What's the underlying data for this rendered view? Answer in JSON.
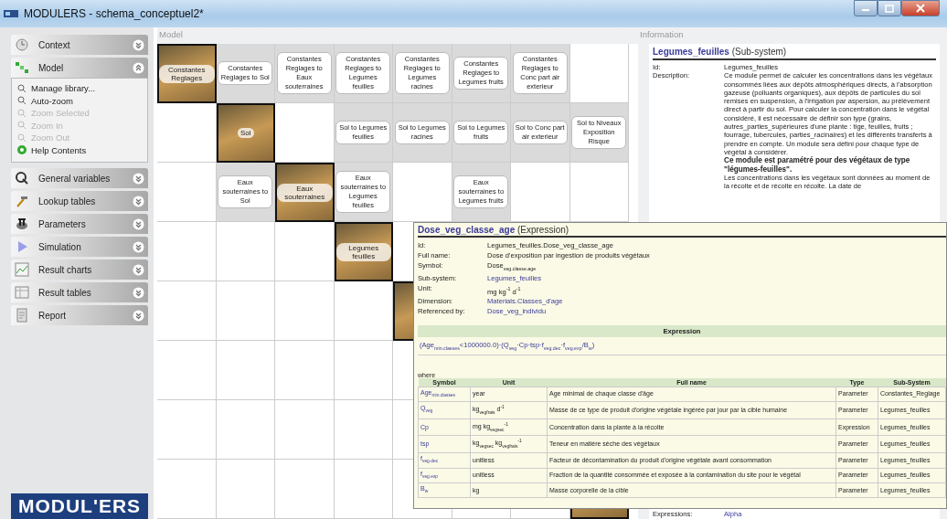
{
  "window": {
    "title": "MODULERS - schema_conceptuel2*"
  },
  "sidebar": {
    "sections": [
      {
        "label": "Context",
        "expanded": false
      },
      {
        "label": "Model",
        "expanded": true,
        "items": [
          {
            "label": "Manage library...",
            "disabled": false
          },
          {
            "label": "Auto-zoom",
            "disabled": false
          },
          {
            "label": "Zoom Selected",
            "disabled": true
          },
          {
            "label": "Zoom In",
            "disabled": true
          },
          {
            "label": "Zoom Out",
            "disabled": true
          },
          {
            "label": "Help Contents",
            "disabled": false
          }
        ]
      },
      {
        "label": "General variables",
        "expanded": false
      },
      {
        "label": "Lookup tables",
        "expanded": false
      },
      {
        "label": "Parameters",
        "expanded": false
      },
      {
        "label": "Simulation",
        "expanded": false
      },
      {
        "label": "Result charts",
        "expanded": false
      },
      {
        "label": "Result tables",
        "expanded": false
      },
      {
        "label": "Report",
        "expanded": false
      }
    ],
    "logo": "MODUL'ERS"
  },
  "model": {
    "legend": "Model",
    "rows": [
      [
        {
          "kind": "node",
          "label": "Constantes Reglages"
        },
        {
          "kind": "link",
          "label": "Constantes Reglages to Sol"
        },
        {
          "kind": "link",
          "label": "Constantes Reglages to Eaux souterraines"
        },
        {
          "kind": "link",
          "label": "Constantes Reglages to Legumes feuilles"
        },
        {
          "kind": "link",
          "label": "Constantes Reglages to Legumes racines"
        },
        {
          "kind": "link",
          "label": "Constantes Reglages to Legumes fruits"
        },
        {
          "kind": "link",
          "label": "Constantes Reglages to Conc part air exterieur"
        },
        {
          "kind": "empty"
        }
      ],
      [
        {
          "kind": "empty"
        },
        {
          "kind": "node",
          "label": "Sol"
        },
        {
          "kind": "empty"
        },
        {
          "kind": "link",
          "label": "Sol to Legumes feuilles"
        },
        {
          "kind": "link",
          "label": "Sol to Legumes racines"
        },
        {
          "kind": "link",
          "label": "Sol to Legumes fruits"
        },
        {
          "kind": "link",
          "label": "Sol to Conc part air exterieur"
        },
        {
          "kind": "link",
          "label": "Sol to Niveaux Exposition Risque"
        }
      ],
      [
        {
          "kind": "empty"
        },
        {
          "kind": "link",
          "label": "Eaux souterraines to Sol"
        },
        {
          "kind": "node",
          "label": "Eaux souterraines"
        },
        {
          "kind": "link",
          "label": "Eaux souterraines to Legumes feuilles"
        },
        {
          "kind": "empty"
        },
        {
          "kind": "link",
          "label": "Eaux souterraines to Legumes fruits"
        },
        {
          "kind": "empty"
        },
        {
          "kind": "empty"
        }
      ],
      [
        {
          "kind": "empty"
        },
        {
          "kind": "empty"
        },
        {
          "kind": "empty"
        },
        {
          "kind": "node",
          "label": "Legumes feuilles"
        },
        {
          "kind": "empty"
        },
        {
          "kind": "empty"
        },
        {
          "kind": "empty"
        },
        {
          "kind": "empty"
        }
      ],
      [
        {
          "kind": "empty"
        },
        {
          "kind": "empty"
        },
        {
          "kind": "empty"
        },
        {
          "kind": "empty"
        },
        {
          "kind": "node"
        },
        {
          "kind": "empty"
        },
        {
          "kind": "empty"
        },
        {
          "kind": "empty"
        }
      ],
      [
        {
          "kind": "empty"
        },
        {
          "kind": "empty"
        },
        {
          "kind": "empty"
        },
        {
          "kind": "empty"
        },
        {
          "kind": "empty"
        },
        {
          "kind": "empty"
        },
        {
          "kind": "empty"
        },
        {
          "kind": "empty"
        }
      ],
      [
        {
          "kind": "empty"
        },
        {
          "kind": "empty"
        },
        {
          "kind": "empty"
        },
        {
          "kind": "empty"
        },
        {
          "kind": "empty"
        },
        {
          "kind": "empty"
        },
        {
          "kind": "empty"
        },
        {
          "kind": "empty"
        }
      ],
      [
        {
          "kind": "empty"
        },
        {
          "kind": "empty"
        },
        {
          "kind": "empty"
        },
        {
          "kind": "empty"
        },
        {
          "kind": "empty"
        },
        {
          "kind": "empty"
        },
        {
          "kind": "empty"
        },
        {
          "kind": "node"
        }
      ]
    ]
  },
  "information": {
    "legend": "Information",
    "title": "Legumes_feuilles",
    "title_kind": "(Sub-system)",
    "id_label": "Id:",
    "id_value": "Legumes_feuilles",
    "description_label": "Description:",
    "description": [
      {
        "text": "Ce module permet de calculer les concentrations dans les végétaux consommés liées aux dépôts atmosphériques directs, à l'absorption gazeuse (polluants organiques), aux dépôts de particules du sol remises en suspension, à l'irrigation par aspersion, au prélèvement direct à partir du sol. Pour calculer la concentration dans le végétal considéré, il est nécessaire de définir son type (grains, autres_parties_supérieures d'une plante : tige, feuilles, fruits ; fourrage, tubercules, parties_racinaires) et les différents transferts à prendre en compte. Un module sera défini pour chaque type de végétal à considérer.",
        "bold": false
      },
      {
        "text": "Ce module est paramétré pour des végétaux de type \"légumes-feuilles\".",
        "bold": true
      },
      {
        "text": "Les concentrations dans les végétaux sont données au moment de la récolte et de récolte en récolte. La date de",
        "bold": false
      }
    ],
    "expressions_label": "Expressions:",
    "expressions_value": "Alpha"
  },
  "popup": {
    "title": "Dose_veg_classe_age",
    "title_kind": "(Expression)",
    "fields": [
      {
        "label": "Id:",
        "value": "Legumes_feuilles.Dose_veg_classe_age",
        "link": false
      },
      {
        "label": "Full name:",
        "value": "Dose d'exposition par ingestion de produits végétaux",
        "link": false
      },
      {
        "label": "Symbol:",
        "value": "Dose$_{veg.classe.age}$",
        "link": false
      },
      {
        "label": "Sub-system:",
        "value": "Legumes_feuilles",
        "link": true
      },
      {
        "label": "Unit:",
        "value": "mg kg$^{-1}$ d$^{-1}$",
        "link": false
      },
      {
        "label": "Dimension:",
        "value": "Materials.Classes_d'age",
        "link": true
      },
      {
        "label": "Referenced by:",
        "value": "Dose_veg_individu",
        "link": true
      }
    ],
    "expression_heading": "Expression",
    "expression": "(Age$_{min.classes}$<1000000.0)·(Q$_{veg}$·Cp·tsp·f$_{veg.dec}$·f$_{veg.exp}$/B$_{w}$)",
    "where_label": "where",
    "table": {
      "columns": [
        "Symbol",
        "Unit",
        "Full name",
        "Type",
        "Sub-System"
      ],
      "rows": [
        [
          "Age$_{min.classes}$",
          "year",
          "Age minimal de chaque classe d'âge",
          "Parameter",
          "Constantes_Reglage"
        ],
        [
          "Q$_{veg}$",
          "kg$_{vegfrais}$ d$^{-1}$",
          "Masse de ce type de produit d'origine végétale ingérée par jour par la cible humaine",
          "Parameter",
          "Legumes_feuilles"
        ],
        [
          "Cp",
          "mg kg$_{vegsec}$$^{-1}$",
          "Concentration dans la plante à la récolte",
          "Expression",
          "Legumes_feuilles"
        ],
        [
          "tsp",
          "kg$_{vegsec}$ kg$_{vegfrais}$$^{-1}$",
          "Teneur en matière sèche des végétaux",
          "Parameter",
          "Legumes_feuilles"
        ],
        [
          "f$_{veg.dec}$",
          "unitless",
          "Facteur de décontamination du produit d'origine végétale avant consommation",
          "Parameter",
          "Legumes_feuilles"
        ],
        [
          "f$_{veg.exp}$",
          "unitless",
          "Fraction de la quantité consommée et exposée à la contamination du site pour le végétal",
          "Parameter",
          "Legumes_feuilles"
        ],
        [
          "B$_{w}$",
          "kg",
          "Masse corporelle de la cible",
          "Parameter",
          "Legumes_feuilles"
        ]
      ]
    }
  }
}
